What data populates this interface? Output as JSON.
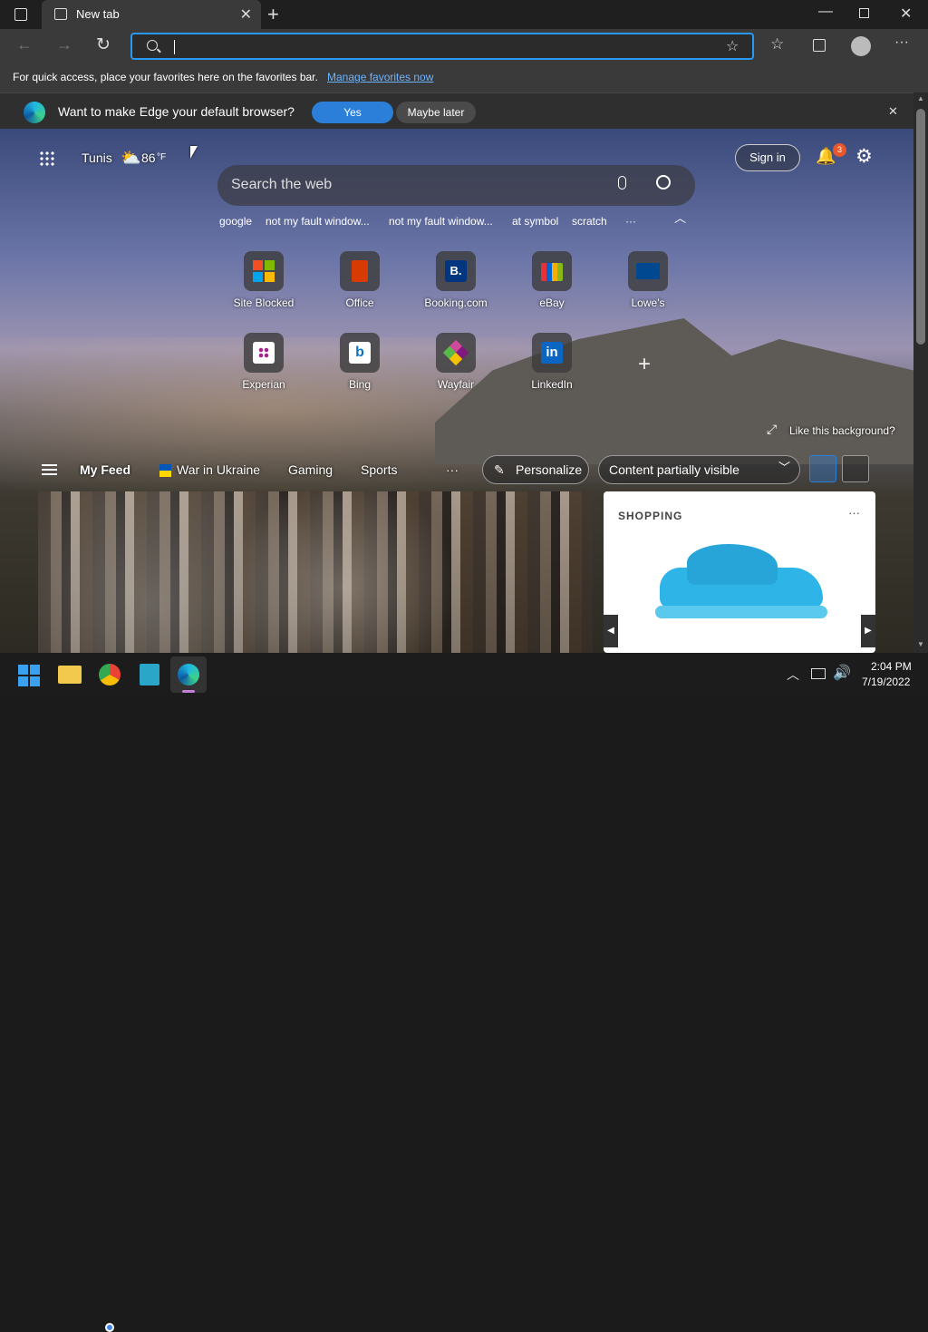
{
  "browser": {
    "tab_title": "New tab",
    "favbar_text": "For quick access, place your favorites here on the favorites bar.",
    "favbar_link": "Manage favorites now",
    "infobar_message": "Want to make Edge your default browser?",
    "infobar_yes": "Yes",
    "infobar_later": "Maybe later"
  },
  "newtab": {
    "city": "Tunis",
    "temperature": "86",
    "temp_unit": "°F",
    "sign_in": "Sign in",
    "notification_count": "3",
    "search_placeholder": "Search the web",
    "suggestions": [
      "google",
      "not my fault window...",
      "not my fault window...",
      "at symbol",
      "scratch"
    ],
    "more": "···",
    "tiles": [
      {
        "label": "Site Blocked"
      },
      {
        "label": "Office"
      },
      {
        "label": "Booking.com",
        "glyph": "B."
      },
      {
        "label": "eBay"
      },
      {
        "label": "Lowe's"
      },
      {
        "label": "Experian"
      },
      {
        "label": "Bing",
        "glyph": "b"
      },
      {
        "label": "Wayfair"
      },
      {
        "label": "LinkedIn",
        "glyph": "in"
      }
    ],
    "like_background": "Like this background?",
    "feed": {
      "my_feed": "My Feed",
      "war_in_ukraine": "War in Ukraine",
      "gaming": "Gaming",
      "sports": "Sports",
      "more": "···",
      "personalize": "Personalize",
      "content_visibility": "Content partially visible"
    },
    "shopping_card": {
      "title": "SHOPPING",
      "more": "···"
    }
  },
  "taskbar": {
    "time": "2:04 PM",
    "date": "7/19/2022"
  },
  "colors": {
    "accent": "#2b7fd9",
    "omnibox_border": "#2899f5",
    "notification_badge": "#e8572b",
    "shoe": "#2fb4e8"
  }
}
